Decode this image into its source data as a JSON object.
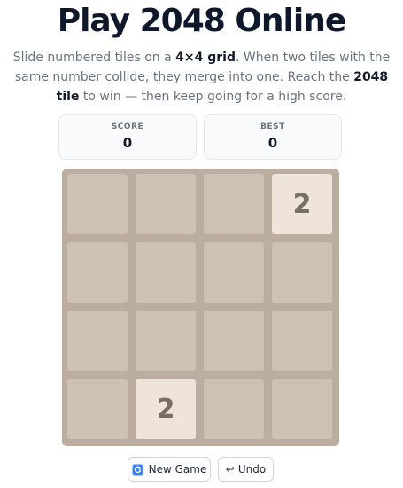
{
  "page": {
    "title": "Play 2048 Online",
    "description": {
      "part1": "Slide numbered tiles on a ",
      "bold1": "4×4 grid",
      "part2": ". When two tiles with the same number collide, they merge into one. Reach the ",
      "bold2": "2048 tile",
      "part3": " to win — then keep going for a high score."
    }
  },
  "scoreboard": {
    "score_label": "SCORE",
    "score_value": "0",
    "best_label": "BEST",
    "best_value": "0"
  },
  "board": {
    "size": 4,
    "cells": [
      "",
      "",
      "",
      "2",
      "",
      "",
      "",
      "",
      "",
      "",
      "",
      "",
      "",
      "2",
      "",
      ""
    ]
  },
  "controls": {
    "new_game_label": "New Game",
    "new_game_icon": "refresh-icon",
    "undo_label": "Undo",
    "undo_icon": "undo-arrow-icon",
    "undo_glyph": "↩"
  },
  "colors": {
    "board_background": "#bbada0",
    "empty_cell": "#cdc1b4",
    "tile_2": "#eee4da",
    "tile_text": "#776e65",
    "title_color": "#0f172a"
  }
}
